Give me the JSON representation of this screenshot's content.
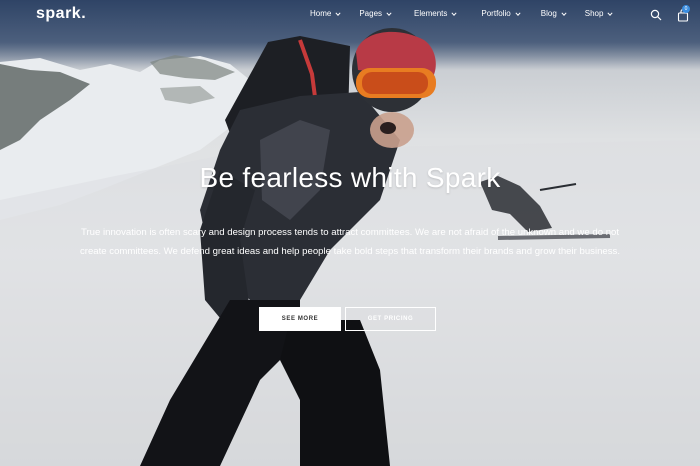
{
  "brand": {
    "logo_text": "spark."
  },
  "nav": {
    "items": [
      {
        "label": "Home",
        "icon": "chevron-down-icon"
      },
      {
        "label": "Pages",
        "icon": "chevron-down-icon"
      },
      {
        "label": "Elements",
        "icon": "chevron-down-icon"
      },
      {
        "label": "Portfolio",
        "icon": "chevron-down-icon"
      },
      {
        "label": "Blog",
        "icon": "chevron-down-icon"
      },
      {
        "label": "Shop",
        "icon": "chevron-down-icon"
      }
    ],
    "search_icon": "search-icon",
    "cart_icon": "shopping-bag-icon",
    "cart_count": "0"
  },
  "hero": {
    "headline": "Be fearless whith Spark",
    "lead": "True innovation is often scary and design process tends to attract committees. We are not afraid of the unknown and we do not create committees. We defend great ideas and help people take bold steps that transform their brands and grow their business.",
    "primary_button": "SEE MORE",
    "secondary_button": "GET PRICING"
  },
  "colors": {
    "accent": "#3a8de0",
    "text": "#ffffff",
    "button_text": "#333333"
  }
}
